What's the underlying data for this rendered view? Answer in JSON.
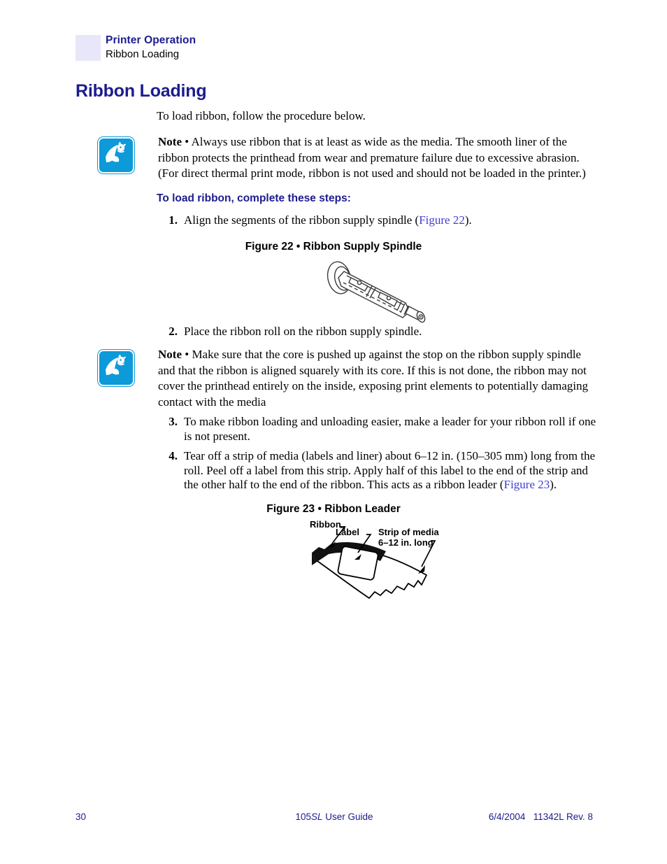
{
  "header": {
    "chapter": "Printer Operation",
    "section": "Ribbon Loading",
    "swatch_color": "#e7e7f9",
    "title_color": "#1c1c8e"
  },
  "chapter_title": "Ribbon Loading",
  "intro": "To load ribbon, follow the procedure below.",
  "notes": [
    {
      "label": "Note",
      "bullet": "•",
      "text": "Always use ribbon that is at least as wide as the media. The smooth liner of the ribbon protects the printhead from wear and premature failure due to excessive abrasion. (For direct thermal print mode, ribbon is not used and should not be loaded in the printer.)",
      "icon": "zebra-note-icon",
      "icon_color": "#0d9ad8"
    },
    {
      "label": "Note",
      "bullet": "•",
      "text": "Make sure that the core is pushed up against the stop on the ribbon supply spindle and that the ribbon is aligned squarely with its core. If this is not done, the ribbon may not cover the printhead entirely on the inside, exposing print elements to potentially damaging contact with the media",
      "icon": "zebra-note-icon",
      "icon_color": "#0d9ad8"
    }
  ],
  "sub_heading": "To load ribbon, complete these steps:",
  "steps": [
    {
      "number": "1.",
      "text_before": "Align the segments of the ribbon supply spindle (",
      "link": "Figure 22",
      "text_after": ")."
    },
    {
      "number": "2.",
      "text_before": "Place the ribbon roll on the ribbon supply spindle.",
      "link": "",
      "text_after": ""
    },
    {
      "number": "3.",
      "text_before": "To make ribbon loading and unloading easier, make a leader for your ribbon roll if one is not present.",
      "link": "",
      "text_after": ""
    },
    {
      "number": "4.",
      "text_before": "Tear off a strip of media (labels and liner) about 6–12 in. (150–305 mm) long from the roll. Peel off a label from this strip. Apply half of this label to the end of the strip and the other half to the end of the ribbon. This acts as a ribbon leader (",
      "link": "Figure 23",
      "text_after": ")."
    }
  ],
  "figures": [
    {
      "caption": "Figure 22 • Ribbon Supply Spindle",
      "alt": "ribbon-supply-spindle-illustration"
    },
    {
      "caption": "Figure 23 • Ribbon Leader",
      "alt": "ribbon-leader-illustration",
      "callouts": {
        "ribbon": "Ribbon",
        "label": "Label",
        "strip_line1": "Strip of media",
        "strip_line2": "6–12 in. long"
      }
    }
  ],
  "footer": {
    "page_number": "30",
    "guide_prefix": "105",
    "guide_italic": "SL",
    "guide_suffix": " User Guide",
    "date": "6/4/2004",
    "revision": "11342L Rev. 8",
    "color": "#1c1c8e"
  }
}
